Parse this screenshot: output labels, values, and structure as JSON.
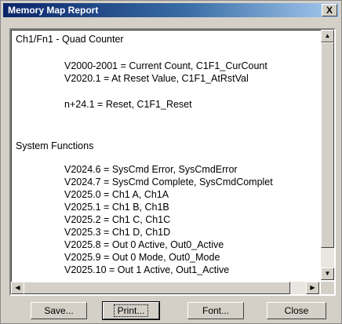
{
  "window": {
    "title": "Memory Map Report",
    "close_glyph": "X"
  },
  "report": {
    "lines": [
      "Ch1/Fn1 - Quad Counter",
      "V2000-2001 = Current Count, C1F1_CurCount",
      "V2020.1 = At Reset Value, C1F1_AtRstVal",
      "n+24.1 = Reset, C1F1_Reset",
      "System Functions",
      "V2024.6 = SysCmd Error, SysCmdError",
      "V2024.7 = SysCmd Complete, SysCmdComplet",
      "V2025.0 = Ch1 A, Ch1A",
      "V2025.1 = Ch1 B, Ch1B",
      "V2025.2 = Ch1 C, Ch1C",
      "V2025.3 = Ch1 D, Ch1D",
      "V2025.8 = Out 0 Active, Out0_Active",
      "V2025.9 = Out 0 Mode, Out0_Mode",
      "V2025.10 = Out 1 Active, Out1_Active"
    ]
  },
  "scrollbars": {
    "up_arrow_icon": "triangle-up",
    "down_arrow_icon": "triangle-down",
    "left_arrow_icon": "triangle-left",
    "right_arrow_icon": "triangle-right"
  },
  "buttons": {
    "save": "Save...",
    "print": "Print...",
    "font": "Font...",
    "close": "Close"
  }
}
